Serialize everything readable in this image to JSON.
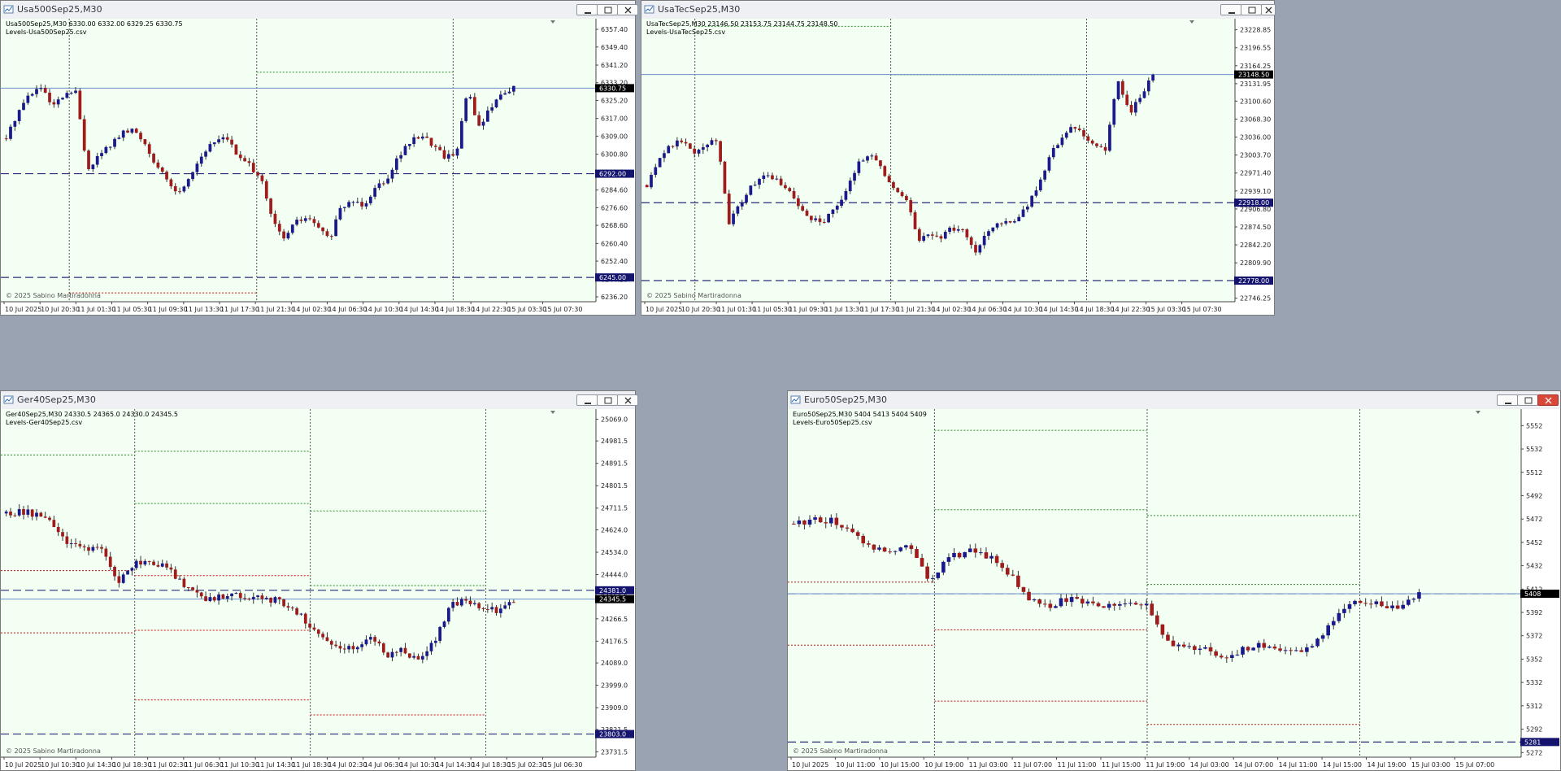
{
  "colors": {
    "bg": "#f3fff3",
    "up": "#1a1a8c",
    "down": "#a01c1c",
    "level_blue": "#2a2a7a",
    "level_green": "#2a8a2a",
    "level_red": "#c41010",
    "grid": "#555555",
    "bid": "#6b90c8",
    "tag_bg": "#14146e",
    "tag_text": "#ffffff",
    "price_bg": "#000000"
  },
  "windows": [
    {
      "title": "Usa500Sep25,M30",
      "header": "Usa500Sep25,M30  6330.00 6332.00 6329.25 6330.75",
      "indicator": "Levels-Usa500Sep25.csv",
      "copyright": "© 2025 Sabino Martiradonna",
      "close_active": false,
      "chart_data": {
        "type": "candlestick",
        "title": "Usa500Sep25,M30",
        "ylim": [
          6234,
          6360
        ],
        "y_ticks": [
          "6357.40",
          "6349.40",
          "6341.20",
          "6333.20",
          "6325.20",
          "6317.00",
          "6309.00",
          "6300.80",
          "6292.80",
          "6284.60",
          "6276.60",
          "6268.60",
          "6260.40",
          "6252.40",
          "6244.20",
          "6236.20"
        ],
        "x_labels": [
          "10 Jul 2025",
          "10 Jul 20:30",
          "11 Jul 01:30",
          "11 Jul 05:30",
          "11 Jul 09:30",
          "11 Jul 13:30",
          "11 Jul 17:30",
          "11 Jul 21:30",
          "14 Jul 02:30",
          "14 Jul 06:30",
          "14 Jul 10:30",
          "14 Jul 14:30",
          "14 Jul 18:30",
          "14 Jul 22:30",
          "15 Jul 03:30",
          "15 Jul 07:30"
        ],
        "price_tag": "6330.75",
        "price": 6330.75,
        "level_tags": [
          {
            "value": 6292.0,
            "label": "6292.00"
          },
          {
            "value": 6245.0,
            "label": "6245.00"
          }
        ],
        "close_path": [
          6308,
          6320,
          6328,
          6331,
          6322,
          6327,
          6330,
          6294,
          6300,
          6305,
          6310,
          6312,
          6306,
          6296,
          6288,
          6283,
          6292,
          6301,
          6306,
          6310,
          6300,
          6296,
          6291,
          6272,
          6262,
          6270,
          6272,
          6268,
          6262,
          6276,
          6280,
          6278,
          6286,
          6290,
          6300,
          6306,
          6310,
          6305,
          6300,
          6301,
          6330,
          6313,
          6322,
          6329,
          6330.75
        ],
        "session_x": [
          0.115,
          0.43,
          0.76
        ],
        "levels": [
          {
            "kind": "green",
            "segments": [
              [
                0.43,
                0.76,
                6338
              ]
            ]
          },
          {
            "kind": "red",
            "segments": [
              [
                0.115,
                0.43,
                6238
              ]
            ]
          }
        ]
      }
    },
    {
      "title": "UsaTecSep25,M30",
      "header": "UsaTecSep25,M30  23146.50 23153.75 23144.75 23148.50",
      "indicator": "Levels-UsaTecSep25.csv",
      "copyright": "© 2025 Sabino Martiradonna",
      "close_active": false,
      "chart_data": {
        "type": "candlestick",
        "title": "UsaTecSep25,M30",
        "ylim": [
          22740,
          23240
        ],
        "y_ticks": [
          "23228.85",
          "23196.55",
          "23164.25",
          "23131.95",
          "23100.60",
          "23068.30",
          "23036.00",
          "23003.70",
          "22971.40",
          "22939.10",
          "22906.80",
          "22874.50",
          "22842.20",
          "22809.90",
          "22778.55",
          "22746.25"
        ],
        "x_labels": [
          "10 Jul 2025",
          "10 Jul 20:30",
          "11 Jul 01:30",
          "11 Jul 05:30",
          "11 Jul 09:30",
          "11 Jul 13:30",
          "11 Jul 17:30",
          "11 Jul 21:30",
          "14 Jul 02:30",
          "14 Jul 06:30",
          "14 Jul 10:30",
          "14 Jul 14:30",
          "14 Jul 18:30",
          "14 Jul 22:30",
          "15 Jul 03:30",
          "15 Jul 07:30"
        ],
        "price_tag": "23148.50",
        "price": 23148.5,
        "level_tags": [
          {
            "value": 22918.0,
            "label": "22918.00"
          },
          {
            "value": 22778.0,
            "label": "22778.00"
          }
        ],
        "close_path": [
          22950,
          23000,
          23020,
          23032,
          23010,
          23026,
          23032,
          22880,
          22920,
          22950,
          22965,
          22960,
          22940,
          22910,
          22890,
          22885,
          22905,
          22940,
          22990,
          23010,
          22975,
          22940,
          22930,
          22850,
          22860,
          22858,
          22872,
          22866,
          22830,
          22870,
          22885,
          22880,
          22905,
          22935,
          22990,
          23030,
          23050,
          23045,
          23020,
          23012,
          23140,
          23080,
          23110,
          23148.5
        ],
        "session_x": [
          0.09,
          0.42,
          0.75
        ],
        "levels": [
          {
            "kind": "green",
            "segments": [
              [
                0.09,
                0.42,
                23235
              ],
              [
                0.42,
                0.75,
                23148
              ]
            ]
          }
        ]
      }
    },
    {
      "title": "Ger40Sep25,M30",
      "header": "Ger40Sep25,M30  24330.5 24365.0 24330.0 24345.5",
      "indicator": "Levels-Ger40Sep25.csv",
      "copyright": "© 2025 Sabino Martiradonna",
      "close_active": false,
      "chart_data": {
        "type": "candlestick",
        "title": "Ger40Sep25,M30",
        "ylim": [
          23710,
          25090
        ],
        "y_ticks": [
          "25069.0",
          "24981.5",
          "24891.5",
          "24801.5",
          "24711.5",
          "24624.0",
          "24534.0",
          "24444.0",
          "24356.5",
          "24266.5",
          "24176.5",
          "24089.0",
          "23999.0",
          "23909.0",
          "23821.5",
          "23731.5"
        ],
        "x_labels": [
          "10 Jul 2025",
          "10 Jul 10:30",
          "10 Jul 14:30",
          "10 Jul 18:30",
          "11 Jul 02:30",
          "11 Jul 06:30",
          "11 Jul 10:30",
          "11 Jul 14:30",
          "11 Jul 18:30",
          "14 Jul 02:30",
          "14 Jul 06:30",
          "14 Jul 10:30",
          "14 Jul 14:30",
          "14 Jul 18:30",
          "15 Jul 02:30",
          "15 Jul 06:30"
        ],
        "price_tag": "24345.5",
        "price": 24345.5,
        "level_tags": [
          {
            "value": 24381.0,
            "label": "24381.0"
          },
          {
            "value": 23803.0,
            "label": "23803.0"
          }
        ],
        "close_path": [
          24690,
          24700,
          24680,
          24640,
          24560,
          24550,
          24545,
          24410,
          24490,
          24500,
          24480,
          24420,
          24360,
          24340,
          24370,
          24360,
          24350,
          24340,
          24320,
          24250,
          24180,
          24160,
          24150,
          24200,
          24120,
          24140,
          24090,
          24180,
          24320,
          24345,
          24310,
          24300,
          24345.5
        ],
        "session_x": [
          0.225,
          0.52,
          0.815
        ],
        "levels": [
          {
            "kind": "green",
            "segments": [
              [
                0.0,
                0.225,
                24925
              ],
              [
                0.225,
                0.52,
                24940
              ],
              [
                0.225,
                0.52,
                24730
              ],
              [
                0.52,
                0.815,
                24700
              ],
              [
                0.52,
                0.815,
                24400
              ]
            ]
          },
          {
            "kind": "red",
            "segments": [
              [
                0.0,
                0.225,
                24460
              ],
              [
                0.225,
                0.52,
                24440
              ],
              [
                0.0,
                0.225,
                24210
              ],
              [
                0.225,
                0.52,
                24220
              ],
              [
                0.225,
                0.52,
                23940
              ],
              [
                0.52,
                0.815,
                23880
              ]
            ]
          }
        ]
      }
    },
    {
      "title": "Euro50Sep25,M30",
      "header": "Euro50Sep25,M30  5404 5413 5404 5409",
      "indicator": "Levels-Euro50Sep25.csv",
      "copyright": "© 2025 Sabino Martiradonna",
      "close_active": true,
      "chart_data": {
        "type": "candlestick",
        "title": "Euro50Sep25,M30",
        "ylim": [
          5268,
          5562
        ],
        "y_ticks": [
          "5552",
          "5532",
          "5512",
          "5492",
          "5472",
          "5452",
          "5432",
          "5412",
          "5392",
          "5372",
          "5352",
          "5332",
          "5312",
          "5292",
          "5272"
        ],
        "x_labels": [
          "10 Jul 2025",
          "10 Jul 11:00",
          "10 Jul 15:00",
          "10 Jul 19:00",
          "11 Jul 03:00",
          "11 Jul 07:00",
          "11 Jul 11:00",
          "11 Jul 15:00",
          "11 Jul 19:00",
          "14 Jul 03:00",
          "14 Jul 07:00",
          "14 Jul 11:00",
          "14 Jul 15:00",
          "14 Jul 19:00",
          "15 Jul 03:00",
          "15 Jul 07:00"
        ],
        "price_tag": "5408",
        "price": 5408,
        "level_tags": [
          {
            "value": 5408.0,
            "label": "5408"
          },
          {
            "value": 5281.0,
            "label": "5281"
          }
        ],
        "close_path": [
          5468,
          5472,
          5470,
          5460,
          5448,
          5446,
          5448,
          5418,
          5440,
          5444,
          5440,
          5426,
          5404,
          5396,
          5404,
          5400,
          5398,
          5402,
          5398,
          5370,
          5360,
          5362,
          5354,
          5360,
          5364,
          5360,
          5356,
          5372,
          5396,
          5402,
          5398,
          5396,
          5409
        ],
        "session_x": [
          0.2,
          0.49,
          0.78
        ],
        "levels": [
          {
            "kind": "green",
            "segments": [
              [
                0.2,
                0.49,
                5548
              ],
              [
                0.2,
                0.49,
                5480
              ],
              [
                0.49,
                0.78,
                5475
              ],
              [
                0.49,
                0.78,
                5416
              ]
            ]
          },
          {
            "kind": "red",
            "segments": [
              [
                0.0,
                0.2,
                5418
              ],
              [
                0.2,
                0.49,
                5377
              ],
              [
                0.0,
                0.2,
                5364
              ],
              [
                0.2,
                0.49,
                5316
              ],
              [
                0.49,
                0.78,
                5296
              ]
            ]
          }
        ]
      }
    }
  ]
}
